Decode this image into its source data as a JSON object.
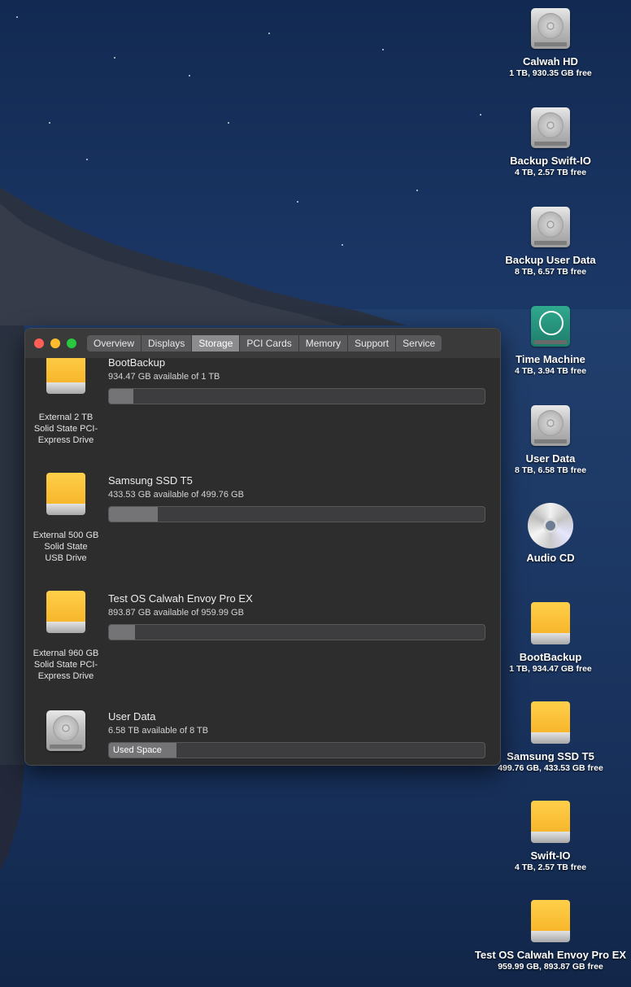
{
  "window": {
    "tabs": [
      "Overview",
      "Displays",
      "Storage",
      "PCI Cards",
      "Memory",
      "Support",
      "Service"
    ],
    "active_tab": "Storage",
    "volumes": [
      {
        "title": "BootBackup",
        "available": "934.47 GB available of 1 TB",
        "desc": [
          "External 2 TB",
          "Solid State PCI-",
          "Express Drive"
        ],
        "used_fraction": 0.065,
        "icon": "external-drive-icon",
        "bar_label": ""
      },
      {
        "title": "Samsung SSD T5",
        "available": "433.53 GB available of 499.76 GB",
        "desc": [
          "External 500 GB",
          "Solid State",
          "USB Drive"
        ],
        "used_fraction": 0.13,
        "icon": "external-drive-icon",
        "bar_label": ""
      },
      {
        "title": "Test OS Calwah Envoy Pro EX",
        "available": "893.87 GB available of 959.99 GB",
        "desc": [
          "External 960 GB",
          "Solid State PCI-",
          "Express Drive"
        ],
        "used_fraction": 0.069,
        "icon": "external-drive-icon",
        "bar_label": ""
      },
      {
        "title": "User Data",
        "available": "6.58 TB available of 8 TB",
        "desc": [],
        "used_fraction": 0.18,
        "icon": "hard-drive-icon",
        "bar_label": "Used Space"
      }
    ]
  },
  "desktop": [
    {
      "name": "Calwah HD",
      "sub": "1 TB, 930.35 GB free",
      "icon": "hard-drive-icon"
    },
    {
      "name": "Backup Swift-IO",
      "sub": "4 TB, 2.57 TB free",
      "icon": "hard-drive-icon"
    },
    {
      "name": "Backup User Data",
      "sub": "8 TB, 6.57 TB free",
      "icon": "hard-drive-icon"
    },
    {
      "name": "Time Machine",
      "sub": "4 TB, 3.94 TB free",
      "icon": "time-machine-icon"
    },
    {
      "name": "User Data",
      "sub": "8 TB, 6.58 TB free",
      "icon": "hard-drive-icon"
    },
    {
      "name": "Audio CD",
      "sub": "",
      "icon": "cd-icon"
    },
    {
      "name": "BootBackup",
      "sub": "1 TB, 934.47 GB free",
      "icon": "external-drive-icon"
    },
    {
      "name": "Samsung SSD T5",
      "sub": "499.76 GB, 433.53 GB free",
      "icon": "external-drive-icon"
    },
    {
      "name": "Swift-IO",
      "sub": "4 TB, 2.57 TB free",
      "icon": "external-drive-icon"
    },
    {
      "name": "Test OS Calwah Envoy Pro EX",
      "sub": "959.99 GB, 893.87 GB free",
      "icon": "external-drive-icon"
    }
  ]
}
